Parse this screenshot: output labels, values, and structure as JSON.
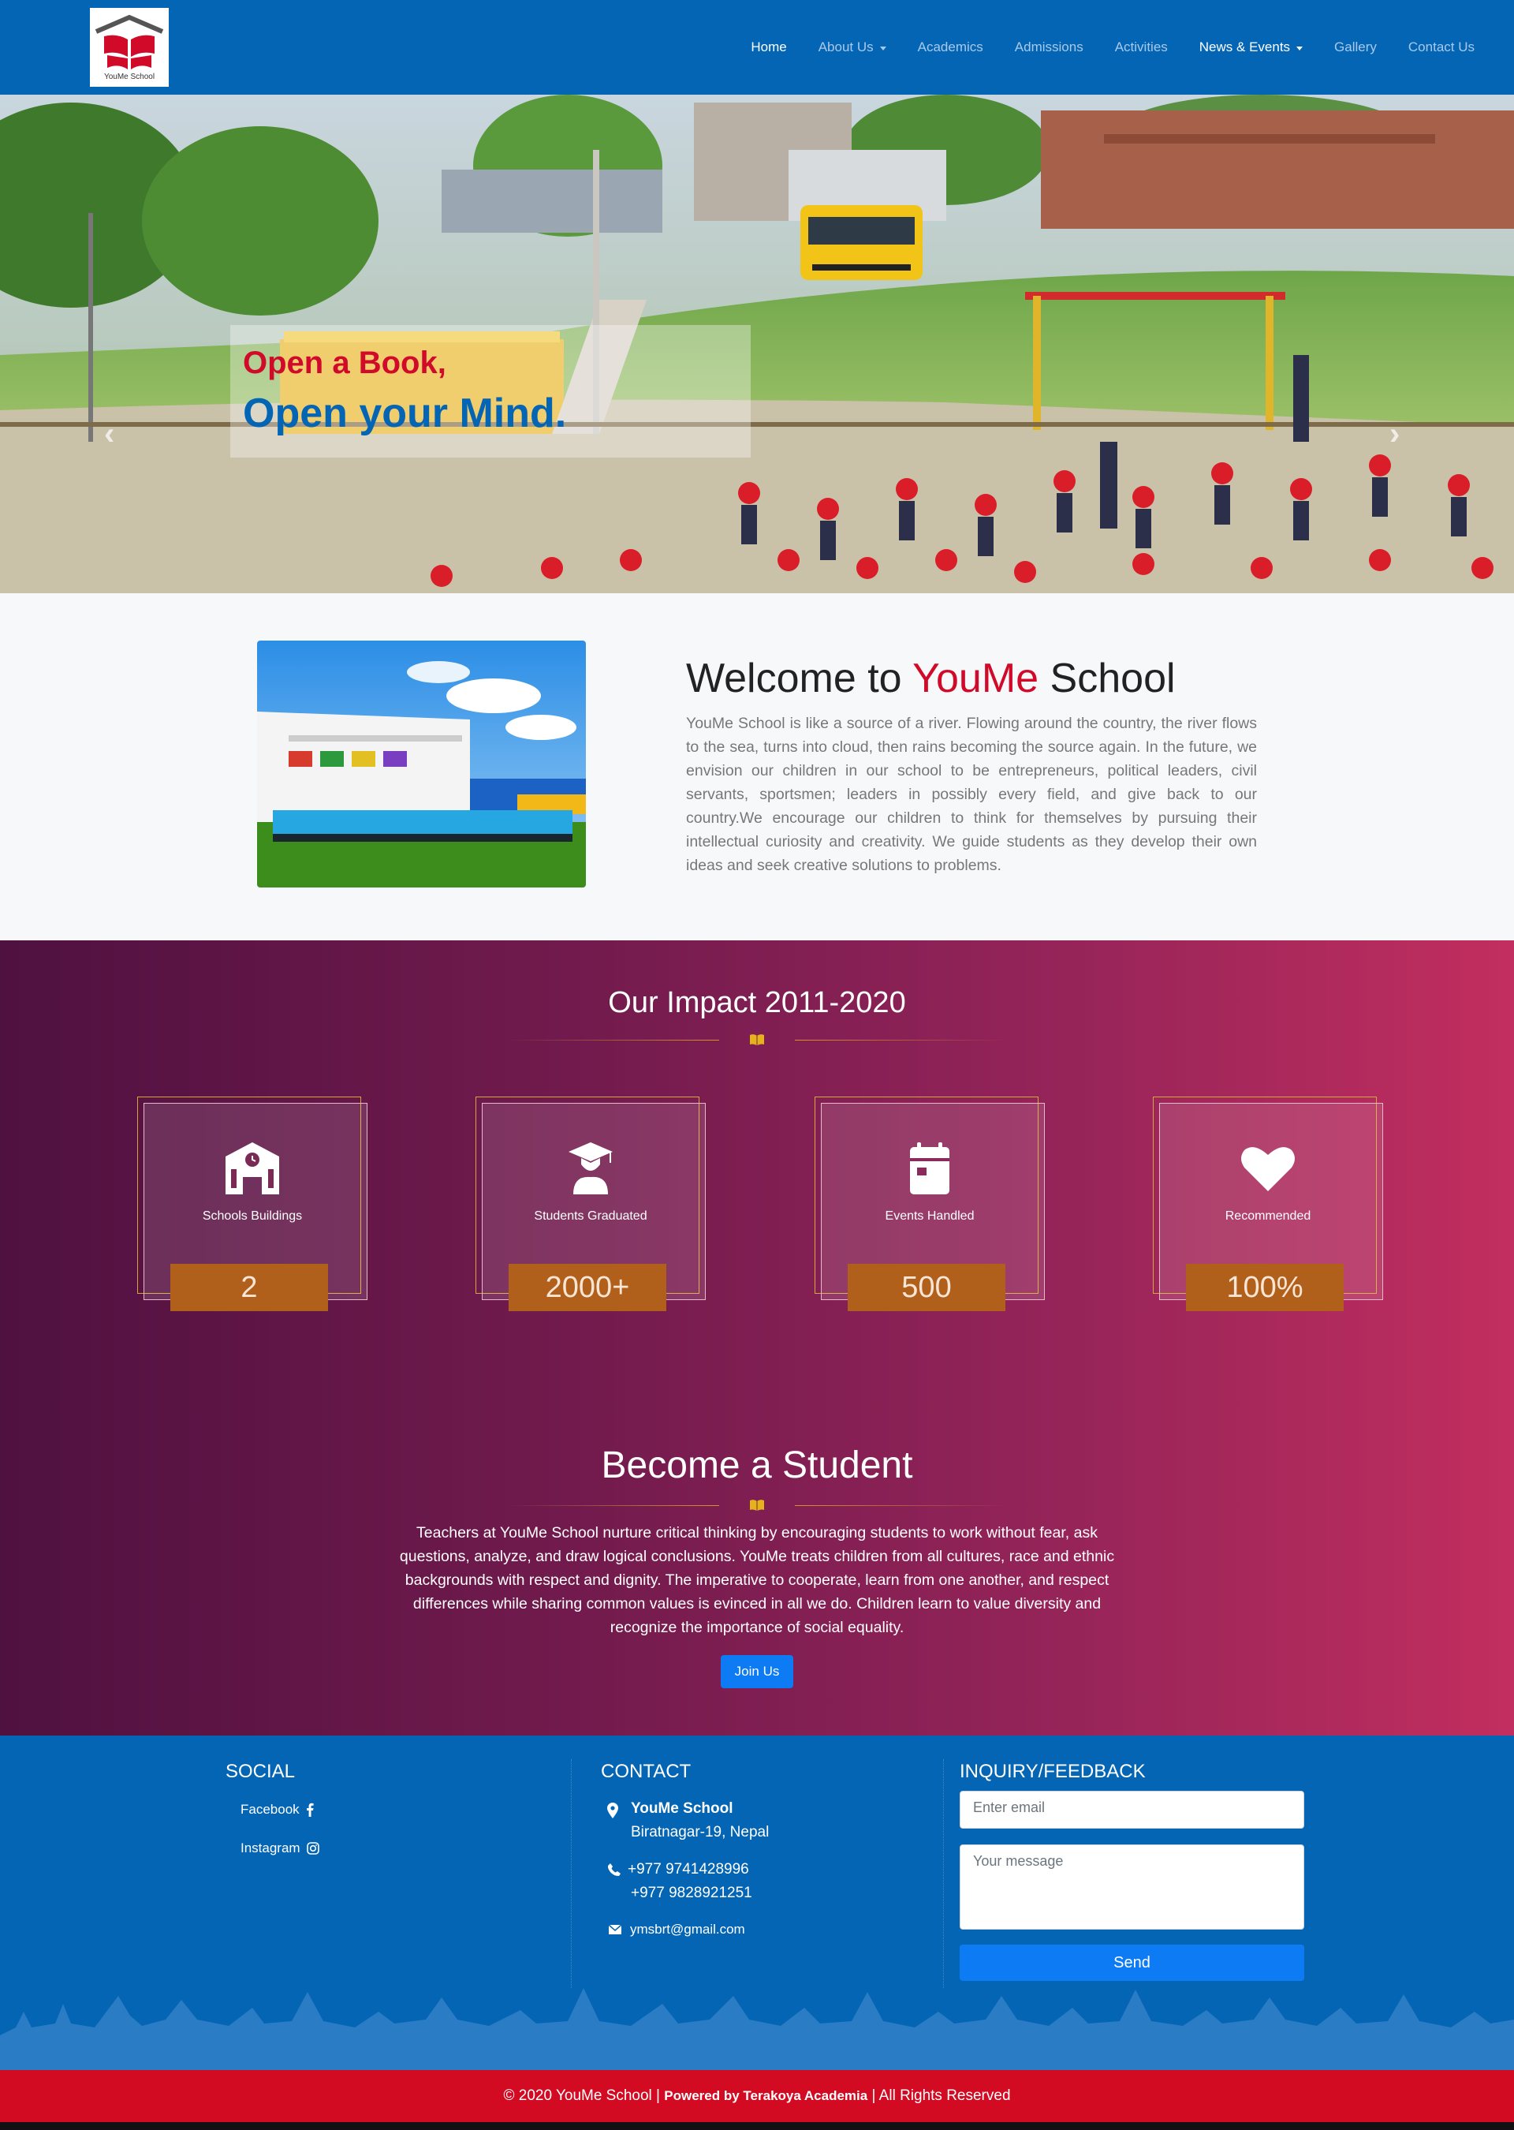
{
  "brand": {
    "logo_text": "YouMe School",
    "colors": {
      "primary": "#0365b4",
      "accent_red": "#d10a2a",
      "button": "#0d7bf3",
      "counter_bg": "#b1601c"
    }
  },
  "nav": {
    "items": [
      {
        "label": "Home",
        "state": "active"
      },
      {
        "label": "About Us",
        "dropdown": true
      },
      {
        "label": "Academics"
      },
      {
        "label": "Admissions"
      },
      {
        "label": "Activities"
      },
      {
        "label": "News & Events",
        "dropdown": true
      },
      {
        "label": "Gallery"
      },
      {
        "label": "Contact Us"
      }
    ]
  },
  "hero": {
    "line1": "Open a Book,",
    "line2": "Open your Mind.",
    "prev_icon": "chevron-left-icon",
    "next_icon": "chevron-right-icon"
  },
  "welcome": {
    "title_pre": "Welcome to ",
    "title_brand": "YouMe",
    "title_post": " School",
    "text": "YouMe School is like a source of a river. Flowing around the country, the river flows to the sea, turns into cloud, then rains becoming the source again. In the future, we envision our children in our school to be entrepreneurs, political leaders, civil servants, sportsmen; leaders in possibly every field, and give back to our country.We encourage our children to think for themselves by pursuing their intellectual curiosity and creativity. We guide students as they develop their own ideas and seek creative solutions to problems."
  },
  "impact": {
    "title": "Our Impact 2011-2020",
    "cards": [
      {
        "icon": "school-building-icon",
        "label": "Schools Buildings",
        "value": "2"
      },
      {
        "icon": "graduate-icon",
        "label": "Students Graduated",
        "value": "2000+"
      },
      {
        "icon": "calendar-icon",
        "label": "Events Handled",
        "value": "500"
      },
      {
        "icon": "heart-icon",
        "label": "Recommended",
        "value": "100%"
      }
    ]
  },
  "become": {
    "title": "Become a Student",
    "text": "Teachers at YouMe School nurture critical thinking by encouraging students to work without fear, ask questions, analyze, and draw logical conclusions. YouMe treats children from all cultures, race and ethnic backgrounds with respect and dignity. The imperative to cooperate, learn from one another, and respect differences while sharing common values is evinced in all we do. Children learn to value diversity and recognize the importance of social equality.",
    "button": "Join Us"
  },
  "footer": {
    "social": {
      "heading": "SOCIAL",
      "links": [
        {
          "label": "Facebook",
          "icon": "facebook-icon"
        },
        {
          "label": "Instagram",
          "icon": "instagram-icon"
        }
      ]
    },
    "contact": {
      "heading": "CONTACT",
      "name": "YouMe School",
      "address": "Biratnagar-19, Nepal",
      "phone1": "+977 9741428996",
      "phone2": "+977 9828921251",
      "email": "ymsbrt@gmail.com"
    },
    "inquiry": {
      "heading": "INQUIRY/FEEDBACK",
      "email_placeholder": "Enter email",
      "message_placeholder": "Your message",
      "send": "Send"
    }
  },
  "copyright": {
    "pre": "© 2020 YouMe School | ",
    "powered": "Powered by Terakoya Academia",
    "post": " | All Rights Reserved"
  }
}
